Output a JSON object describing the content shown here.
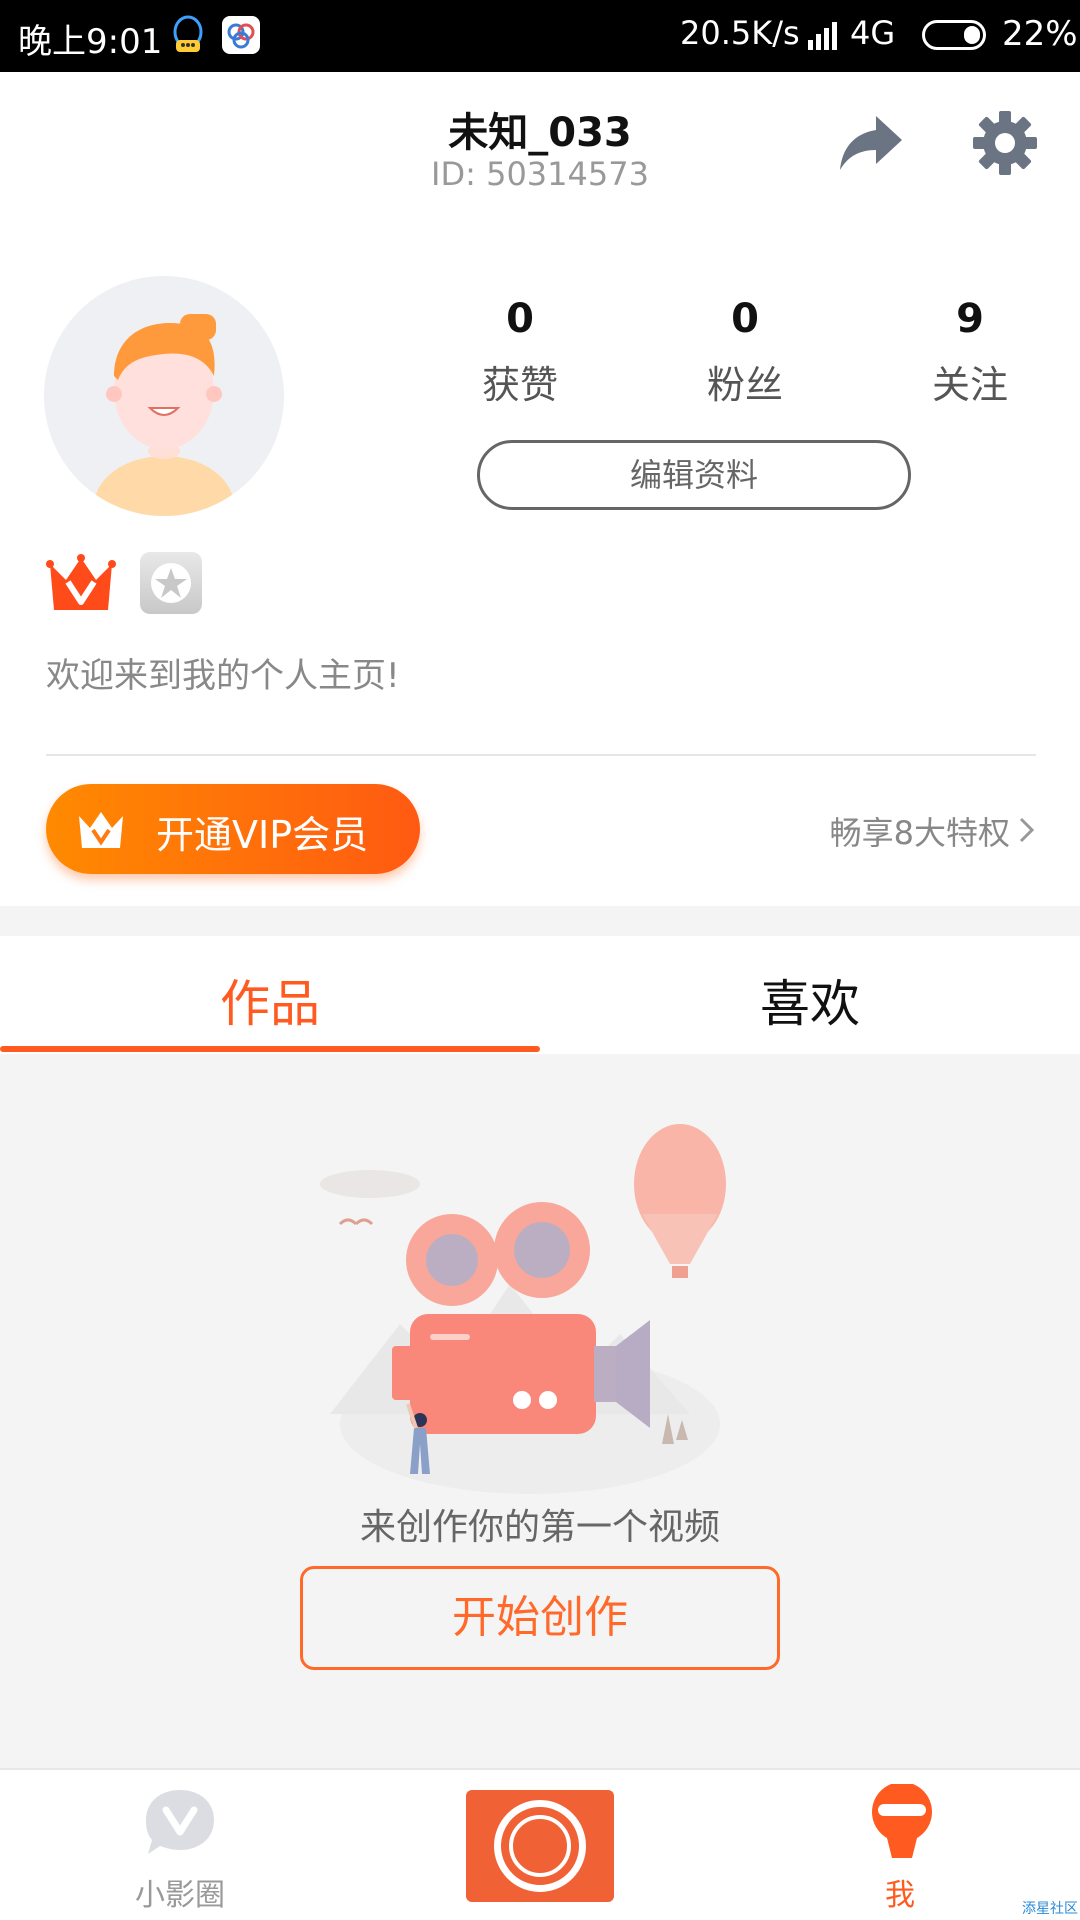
{
  "status_bar": {
    "time": "晚上9:01",
    "speed": "20.5K/s",
    "network": "4G",
    "battery": "22%",
    "icons": [
      "qq-icon",
      "app-icon",
      "signal-icon",
      "battery-icon"
    ]
  },
  "header": {
    "name": "未知_033",
    "id": "ID: 50314573",
    "icons": [
      "share-icon",
      "gear-icon"
    ]
  },
  "profile": {
    "stats": [
      {
        "value": "0",
        "label": "获赞"
      },
      {
        "value": "0",
        "label": "粉丝"
      },
      {
        "value": "9",
        "label": "关注"
      }
    ],
    "edit_label": "编辑资料",
    "bio": "欢迎来到我的个人主页!",
    "badges": [
      "vip-crown-icon",
      "star-icon"
    ]
  },
  "vip": {
    "button_label": "开通VIP会员",
    "perks": "畅享8大特权"
  },
  "tabs": [
    {
      "label": "作品",
      "active": true
    },
    {
      "label": "喜欢",
      "active": false
    }
  ],
  "empty_state": {
    "message": "来创作你的第一个视频",
    "button_label": "开始创作"
  },
  "bottom_nav": {
    "items": [
      {
        "label": "小影圈",
        "icon": "v-circle-icon"
      },
      {
        "label": "",
        "icon": "record-icon"
      },
      {
        "label": "我",
        "icon": "me-icon",
        "active": true
      }
    ]
  },
  "watermark": "添星社区",
  "colors": {
    "accent": "#ff5a1f",
    "vip_gradient_start": "#ff8a00",
    "vip_gradient_end": "#ff5a12",
    "background_gray": "#f4f4f4"
  }
}
